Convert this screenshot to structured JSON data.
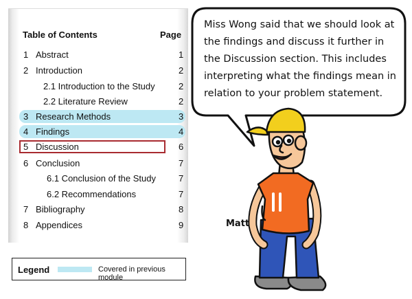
{
  "toc": {
    "heading": "Table of Contents",
    "page_heading": "Page",
    "entries": [
      {
        "num": "1",
        "label": "Abstract",
        "page": "1"
      },
      {
        "num": "2",
        "label": "Introduction",
        "page": "2"
      },
      {
        "num": "",
        "label": "2.1 Introduction to the Study",
        "page": "2"
      },
      {
        "num": "",
        "label": "2.2 Literature Review",
        "page": "2"
      },
      {
        "num": "3",
        "label": "Research Methods",
        "page": "3"
      },
      {
        "num": "4",
        "label": "Findings",
        "page": "4"
      },
      {
        "num": "5",
        "label": "Discussion",
        "page": "6"
      },
      {
        "num": "6",
        "label": "Conclusion",
        "page": "7"
      },
      {
        "num": "",
        "label": "6.1 Conclusion of the Study",
        "page": "7"
      },
      {
        "num": "",
        "label": "6.2 Recommendations",
        "page": "7"
      },
      {
        "num": "7",
        "label": "Bibliography",
        "page": "8"
      },
      {
        "num": "8",
        "label": "Appendices",
        "page": "9"
      }
    ]
  },
  "legend": {
    "title": "Legend",
    "item": "Covered in previous module",
    "swatch_color": "#bde8f3"
  },
  "speech": {
    "lines": [
      "Miss Wong said that we should look at",
      "the findings and discuss it further in",
      "the Discussion section. This includes",
      "interpreting what the findings mean in",
      "relation to your problem statement."
    ]
  },
  "speaker": {
    "name": "Matt"
  },
  "colors": {
    "highlight": "#bde8f3",
    "current_box": "#a82b30",
    "shirt": "#f26b22",
    "pants": "#2f55b8",
    "cap": "#f2cf1d"
  }
}
